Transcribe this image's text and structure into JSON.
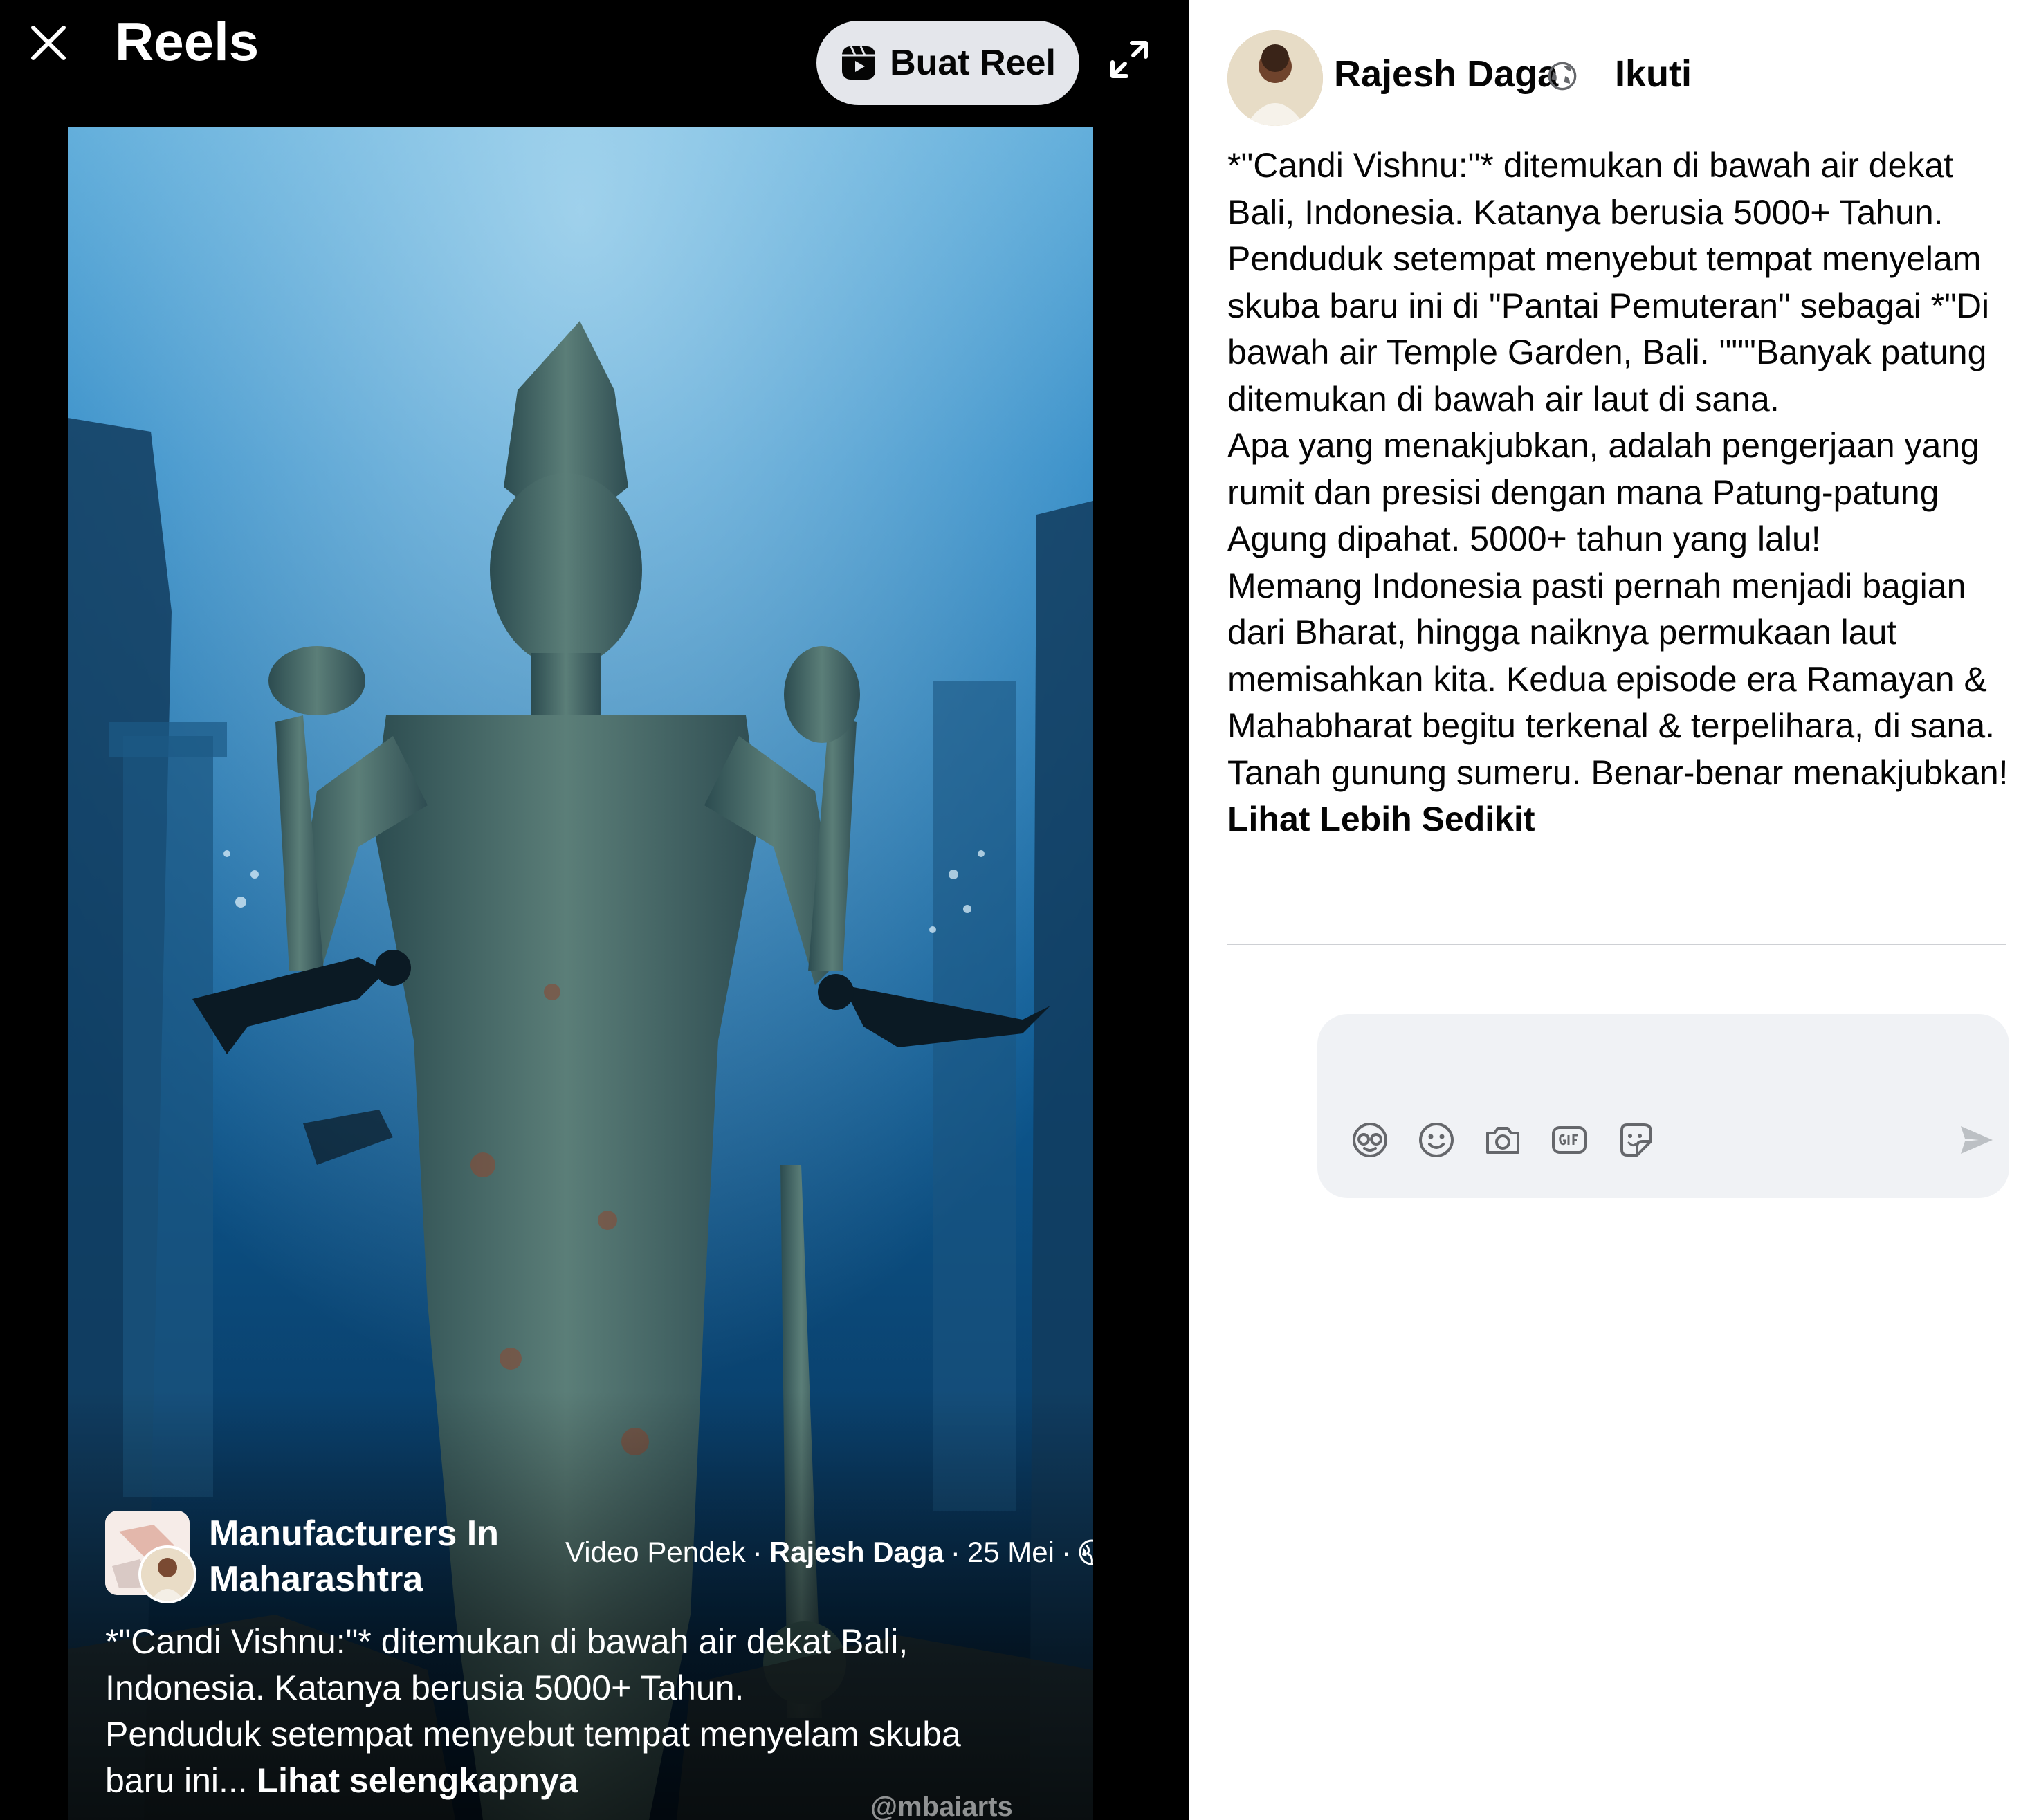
{
  "header": {
    "title": "Reels",
    "create_reel_label": "Buat Reel"
  },
  "reel": {
    "page_name": "Manufacturers In Maharashtra",
    "meta_type": "Video Pendek",
    "meta_sep1": "·",
    "meta_author": "Rajesh Daga",
    "meta_sep2": "·",
    "meta_date": "25 Mei",
    "meta_sep3": "·",
    "caption_lines": [
      "*\"Candi Vishnu:\"* ditemukan di bawah air dekat Bali,",
      "Indonesia. Katanya berusia 5000+ Tahun.",
      "Penduduk setempat menyebut tempat menyelam skuba",
      "baru ini..."
    ],
    "see_more": "Lihat selengkapnya",
    "watermark": "@mbaiarts"
  },
  "post": {
    "author": "Rajesh Daga",
    "follow_label": "Ikuti",
    "paragraphs": [
      "*\"Candi Vishnu:\"* ditemukan di bawah air dekat Bali, Indonesia. Katanya berusia 5000+ Tahun.",
      "Penduduk setempat menyebut tempat menyelam skuba baru ini di \"Pantai Pemuteran\" sebagai *\"Di bawah air Temple Garden, Bali. \"\"\"Banyak patung ditemukan di bawah air laut di sana.",
      "Apa yang menakjubkan, adalah pengerjaan yang rumit dan presisi dengan mana Patung-patung Agung dipahat. 5000+ tahun yang lalu!",
      "Memang Indonesia pasti pernah menjadi bagian dari Bharat, hingga naiknya permukaan laut memisahkan kita. Kedua episode era Ramayan & Mahabharat begitu terkenal & terpelihara, di sana. Tanah gunung sumeru. Benar-benar menakjubkan!"
    ],
    "see_less": "Lihat Lebih Sedikit"
  },
  "comment": {
    "placeholder": "",
    "icons": [
      "avatar-sticker-icon",
      "emoji-icon",
      "camera-icon",
      "gif-icon",
      "sticker-icon"
    ],
    "send_icon": "send-icon"
  },
  "colors": {
    "reels_bg": "#000000",
    "pill_bg": "#e4e6eb",
    "comment_bg": "#f0f2f5",
    "icon_gray": "#65676b",
    "text_primary": "#050505"
  }
}
